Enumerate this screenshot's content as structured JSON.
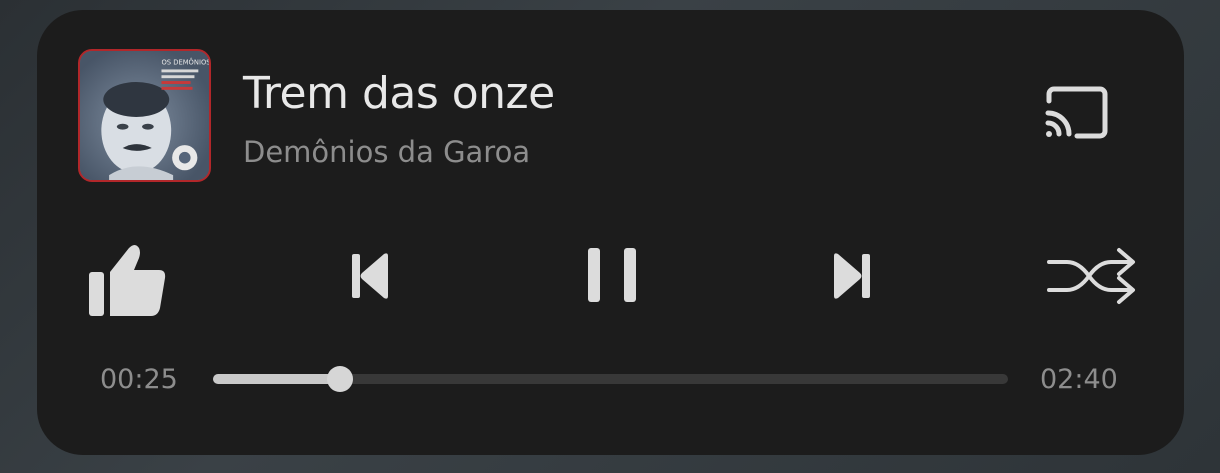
{
  "track": {
    "title": "Trem das onze",
    "artist": "Demônios da Garoa"
  },
  "album_art": {
    "cover_text": "OS DEMÔNIOS DA GAROA"
  },
  "icons": {
    "cast": "cast-icon",
    "like": "thumbs-up-icon",
    "previous": "skip-previous-icon",
    "play_pause": "pause-icon",
    "next": "skip-next-icon",
    "shuffle": "shuffle-icon"
  },
  "progress": {
    "current_time": "00:25",
    "total_time": "02:40",
    "fraction": 0.16
  },
  "colors": {
    "card_background": "#1c1c1c",
    "title": "#e8e8e8",
    "secondary_text": "#8d8d8d",
    "track_empty": "#383838",
    "track_fill": "#c9c9c9",
    "icon": "#dcdcdc"
  }
}
